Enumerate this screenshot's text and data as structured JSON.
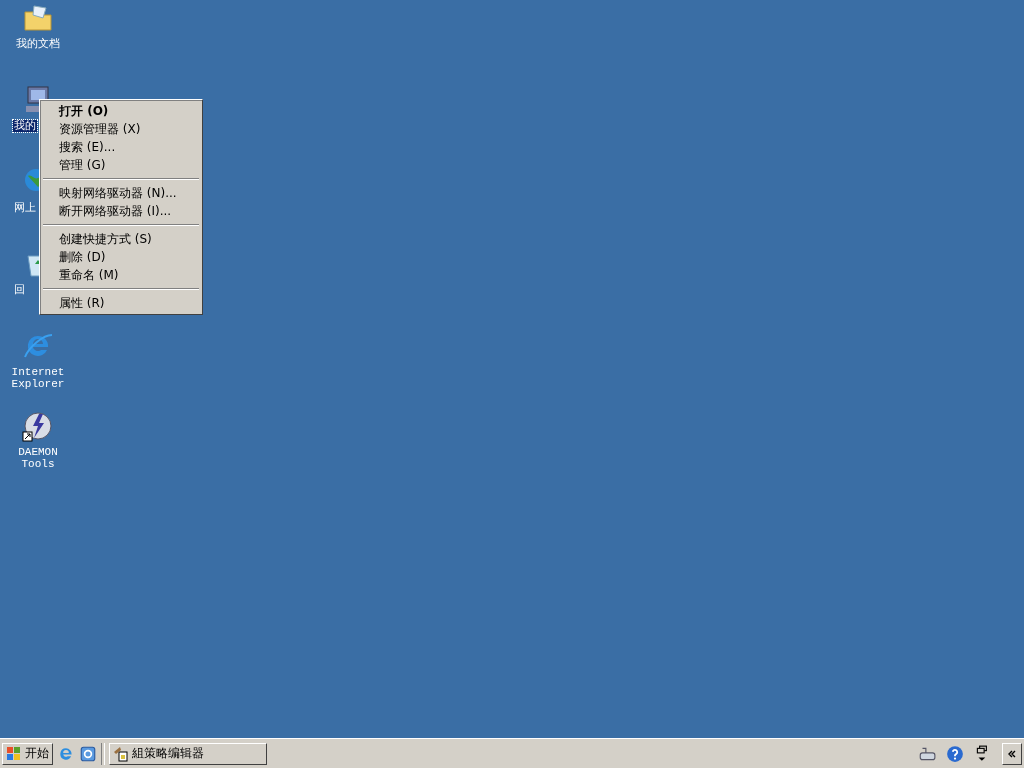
{
  "desktop_icons": [
    {
      "label": "我的文档",
      "kind": "folder",
      "selected": false
    },
    {
      "label": "我的",
      "kind": "computer",
      "selected": true
    },
    {
      "label": "网上",
      "kind": "network",
      "selected": false
    },
    {
      "label": "回",
      "kind": "recycle",
      "selected": false
    },
    {
      "label": "Internet Explorer",
      "kind": "ie",
      "selected": false
    },
    {
      "label": "DAEMON Tools",
      "kind": "daemon",
      "selected": false
    }
  ],
  "context_menu": [
    {
      "kind": "item",
      "label": "打开 (O)",
      "default": true
    },
    {
      "kind": "item",
      "label": "资源管理器 (X)",
      "default": false
    },
    {
      "kind": "item",
      "label": "搜索 (E)...",
      "default": false
    },
    {
      "kind": "item",
      "label": "管理 (G)",
      "default": false
    },
    {
      "kind": "separator"
    },
    {
      "kind": "item",
      "label": "映射网络驱动器 (N)...",
      "default": false
    },
    {
      "kind": "item",
      "label": "断开网络驱动器 (I)...",
      "default": false
    },
    {
      "kind": "separator"
    },
    {
      "kind": "item",
      "label": "创建快捷方式 (S)",
      "default": false
    },
    {
      "kind": "item",
      "label": "删除 (D)",
      "default": false
    },
    {
      "kind": "item",
      "label": "重命名 (M)",
      "default": false
    },
    {
      "kind": "separator"
    },
    {
      "kind": "item",
      "label": "属性 (R)",
      "default": false
    }
  ],
  "taskbar": {
    "start_button": "开始",
    "tasks": [
      {
        "label": "組策略编辑器",
        "selected": false
      }
    ]
  }
}
